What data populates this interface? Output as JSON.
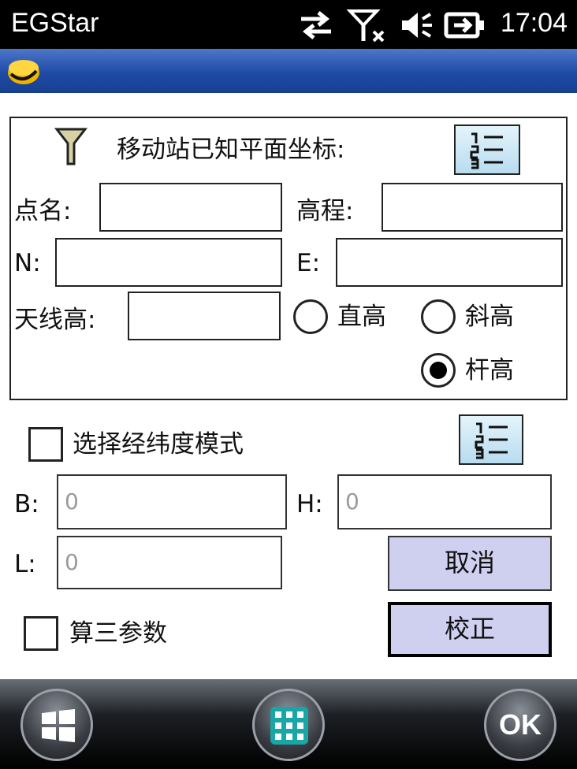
{
  "statusbar": {
    "title": "EGStar",
    "time": "17:04",
    "icons": [
      "sync-arrows-icon",
      "signal-off-icon",
      "volume-muted-icon",
      "battery-charging-icon"
    ]
  },
  "form": {
    "group_title": "移动站已知平面坐标:",
    "point_name_label": "点名:",
    "elevation_label": "高程:",
    "n_label": "N:",
    "e_label": "E:",
    "antenna_height_label": "天线高:",
    "radio_vertical": "直高",
    "radio_slant": "斜高",
    "radio_pole": "杆高",
    "selected_height_mode": "杆高",
    "latlon_mode_label": "选择经纬度模式",
    "latlon_mode_checked": false,
    "b_label": "B:",
    "h_label": "H:",
    "l_label": "L:",
    "b_value": "0",
    "h_value": "0",
    "l_value": "0",
    "cancel_label": "取消",
    "correct_label": "校正",
    "three_param_label": "算三参数",
    "three_param_checked": false
  },
  "bottombar": {
    "ok_label": "OK",
    "icons": [
      "windows-start-icon",
      "keyboard-grid-icon"
    ]
  },
  "colors": {
    "titlebar": "#1e4aa6",
    "button_face": "#cfd0ef",
    "list_button": "#b8dcef"
  }
}
